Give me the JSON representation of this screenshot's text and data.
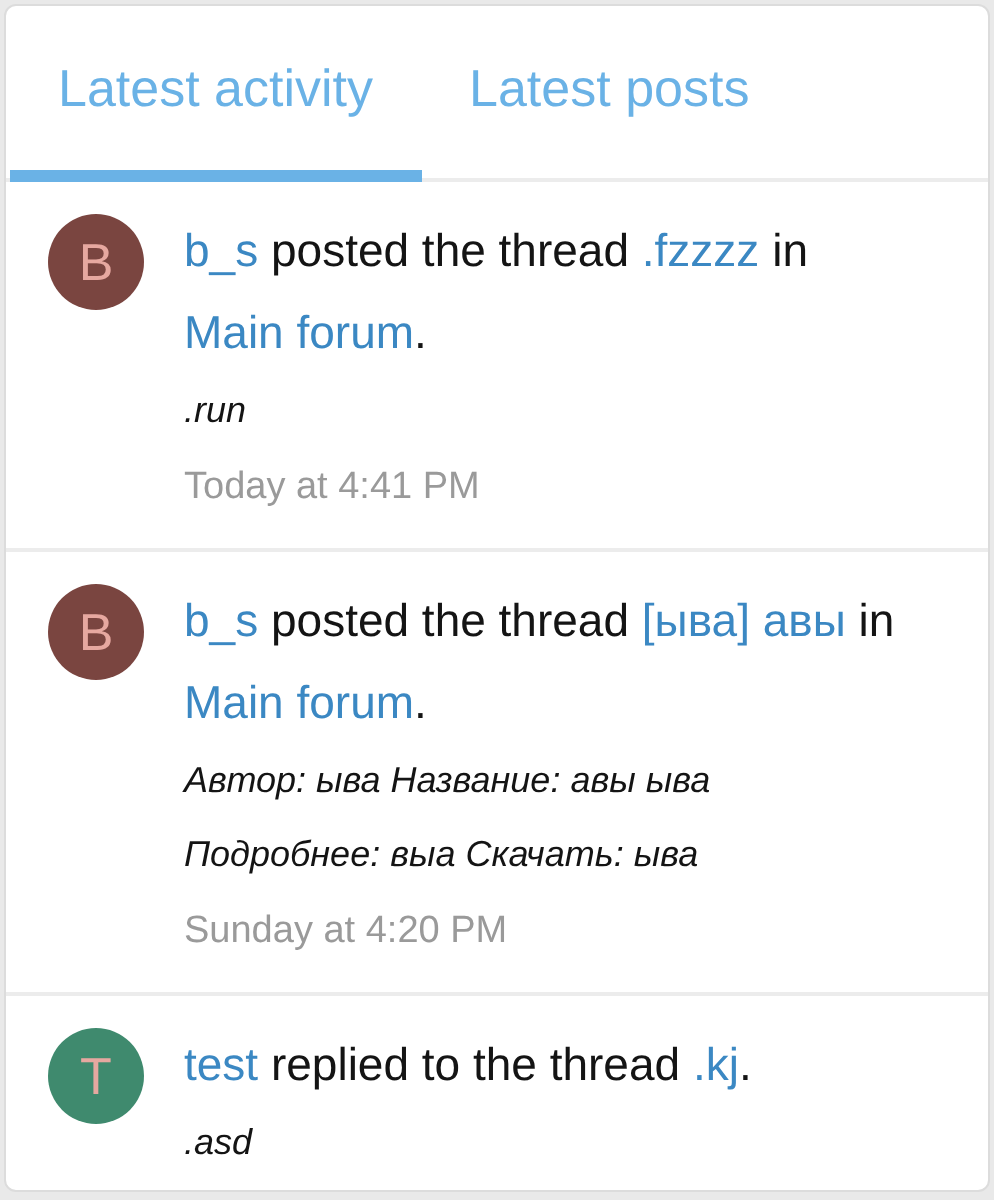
{
  "tabs": [
    {
      "label": "Latest activity",
      "selected": true
    },
    {
      "label": "Latest posts",
      "selected": false
    }
  ],
  "activity": [
    {
      "avatar": {
        "letter": "B",
        "color": "#7a4540"
      },
      "sentence": [
        {
          "kind": "link",
          "text": "b_s"
        },
        {
          "kind": "plain",
          "text": " posted the thread "
        },
        {
          "kind": "link",
          "text": ".fzzzz"
        },
        {
          "kind": "plain",
          "text": " in "
        },
        {
          "kind": "link",
          "text": "Main forum"
        },
        {
          "kind": "plain",
          "text": "."
        }
      ],
      "snippet": [
        ".run"
      ],
      "time": "Today at 4:41 PM"
    },
    {
      "avatar": {
        "letter": "B",
        "color": "#7a4540"
      },
      "sentence": [
        {
          "kind": "link",
          "text": "b_s"
        },
        {
          "kind": "plain",
          "text": " posted the thread "
        },
        {
          "kind": "link",
          "text": "[ыва] авы"
        },
        {
          "kind": "plain",
          "text": " in "
        },
        {
          "kind": "link",
          "text": "Main forum"
        },
        {
          "kind": "plain",
          "text": "."
        }
      ],
      "snippet": [
        "Автор: ыва Название: авы ыва",
        "Подробнее: выа Скачать: ыва"
      ],
      "time": "Sunday at 4:20 PM"
    },
    {
      "avatar": {
        "letter": "T",
        "color": "#3f8a6e"
      },
      "sentence": [
        {
          "kind": "link",
          "text": "test"
        },
        {
          "kind": "plain",
          "text": " replied to the thread "
        },
        {
          "kind": "link",
          "text": ".kj"
        },
        {
          "kind": "plain",
          "text": "."
        }
      ],
      "snippet": [
        ".asd"
      ]
    }
  ]
}
